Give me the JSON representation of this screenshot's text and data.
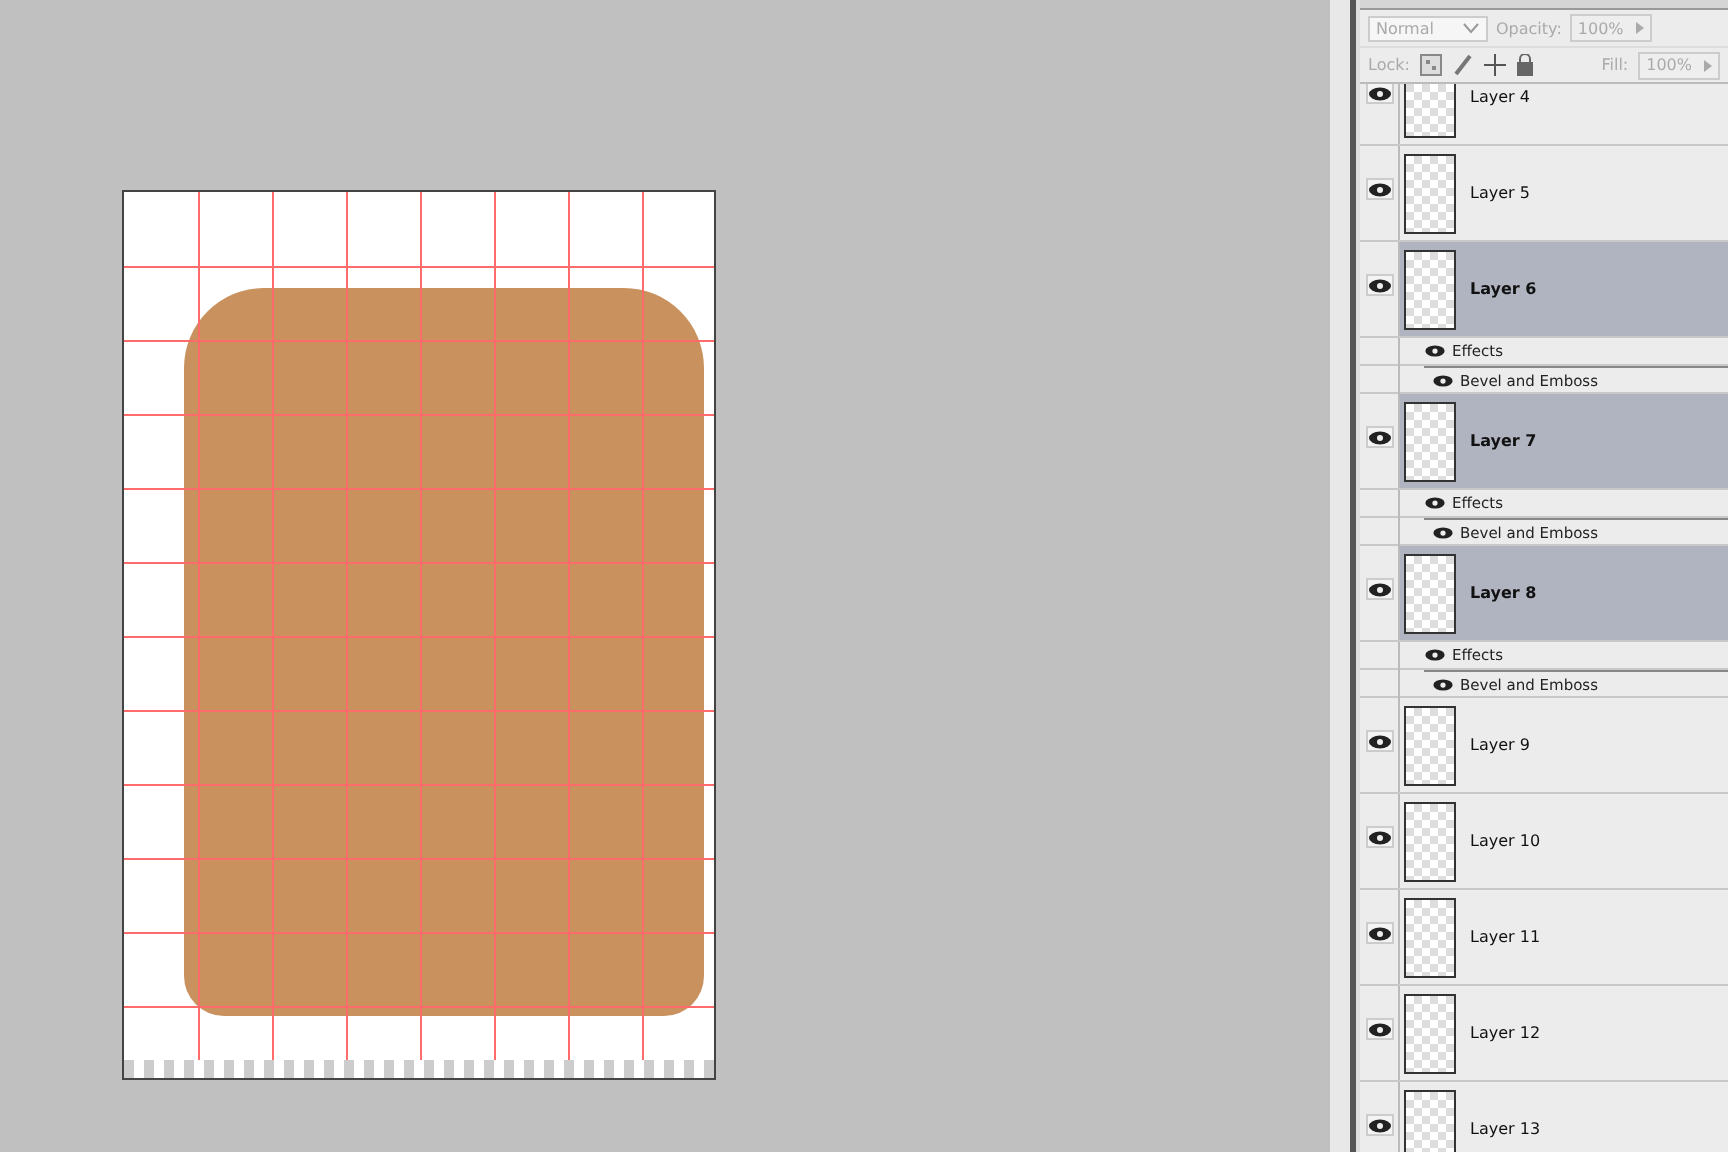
{
  "canvas": {
    "grid": true
  },
  "layers_panel": {
    "blend_mode": "Normal",
    "opacity_label": "Opacity:",
    "opacity": "100%",
    "lock_label": "Lock:",
    "fill_label": "Fill:",
    "fill": "100%",
    "layers": [
      {
        "name": "Layer 4",
        "visible": true,
        "selected": false
      },
      {
        "name": "Layer 5",
        "visible": true,
        "selected": false
      },
      {
        "name": "Layer 6",
        "visible": true,
        "selected": true,
        "effects": {
          "label": "Effects",
          "items": [
            "Bevel and Emboss"
          ]
        }
      },
      {
        "name": "Layer 7",
        "visible": true,
        "selected": true,
        "effects": {
          "label": "Effects",
          "items": [
            "Bevel and Emboss"
          ]
        }
      },
      {
        "name": "Layer 8",
        "visible": true,
        "selected": true,
        "effects": {
          "label": "Effects",
          "items": [
            "Bevel and Emboss"
          ]
        }
      },
      {
        "name": "Layer 9",
        "visible": true,
        "selected": false
      },
      {
        "name": "Layer 10",
        "visible": true,
        "selected": false
      },
      {
        "name": "Layer 11",
        "visible": true,
        "selected": false
      },
      {
        "name": "Layer 12",
        "visible": true,
        "selected": false
      },
      {
        "name": "Layer 13",
        "visible": true,
        "selected": false
      }
    ]
  }
}
